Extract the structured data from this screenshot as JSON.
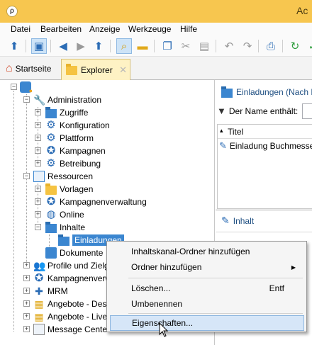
{
  "window": {
    "title": "Ac"
  },
  "menu": [
    "Datei",
    "Bearbeiten",
    "Anzeige",
    "Werkzeuge",
    "Hilfe"
  ],
  "toolbar": {
    "buttons": [
      "new-icon",
      "explorer-icon",
      "back-icon",
      "forward-icon",
      "up-icon",
      "search-icon",
      "folder-icon",
      "copy-icon",
      "cut-icon",
      "paste-icon",
      "undo-icon",
      "redo-icon",
      "print-icon",
      "refresh-icon",
      "check-icon"
    ]
  },
  "tabs": {
    "home": "Startseite",
    "explorer": "Explorer",
    "close": "✕"
  },
  "tree": {
    "root": "",
    "administration": "Administration",
    "zugriffe": "Zugriffe",
    "konfiguration": "Konfiguration",
    "plattform": "Plattform",
    "kampagnen": "Kampagnen",
    "betreibung": "Betreibung",
    "ressourcen": "Ressourcen",
    "vorlagen": "Vorlagen",
    "kampagnenverwaltung": "Kampagnenverwaltung",
    "online": "Online",
    "inhalte": "Inhalte",
    "einladungen": "Einladungen",
    "dokumente": "Dokumente",
    "profile": "Profile und Zielg",
    "kampagnenverw": "Kampagnenverw",
    "mrm": "MRM",
    "angebote_des": "Angebote - Des",
    "angebote_live": "Angebote - Live",
    "message_center": "Message Center"
  },
  "right_panel": {
    "title": "Einladungen (Nach N",
    "filter_label": "Der Name enthält:",
    "column_title": "Titel",
    "row": "Einladung Buchmesse",
    "inhalt": "Inhalt"
  },
  "context_menu": {
    "add_channel_folder": "Inhaltskanal-Ordner hinzufügen",
    "add_folder": "Ordner hinzufügen",
    "delete": "Löschen...",
    "delete_shortcut": "Entf",
    "rename": "Umbenennen",
    "properties": "Eigenschaften..."
  }
}
